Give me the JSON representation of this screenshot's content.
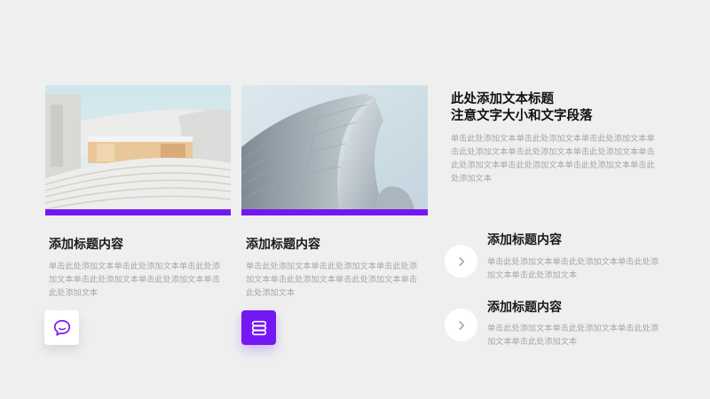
{
  "colors": {
    "accent": "#7417f2",
    "background": "#efefef"
  },
  "header": {
    "title_line1": "此处添加文本标题",
    "title_line2": "注意文字大小和文字段落",
    "body": "单击此处添加文本单击此处添加文本单击此处添加文本单击此处添加文本单击此处添加文本单击此处添加文本单击此处添加文本单击此处添加文本单击此处添加文本单击此处添加文本"
  },
  "columns": [
    {
      "title": "添加标题内容",
      "body": "单击此处添加文本单击此处添加文本单击此处添加文本单击此处添加文本单击此处添加文本单击此处添加文本",
      "icon": "chat-bubble-icon"
    },
    {
      "title": "添加标题内容",
      "body": "单击此处添加文本单击此处添加文本单击此处添加文本单击此处添加文本单击此处添加文本单击此处添加文本",
      "icon": "coins-stack-icon"
    }
  ],
  "items": [
    {
      "title": "添加标题内容",
      "body": "单击此处添加文本单击此处添加文本单击此处添加文本单击此处添加文本",
      "icon": "chevron-right-icon"
    },
    {
      "title": "添加标题内容",
      "body": "单击此处添加文本单击此处添加文本单击此处添加文本单击此处添加文本",
      "icon": "chevron-right-icon"
    }
  ]
}
